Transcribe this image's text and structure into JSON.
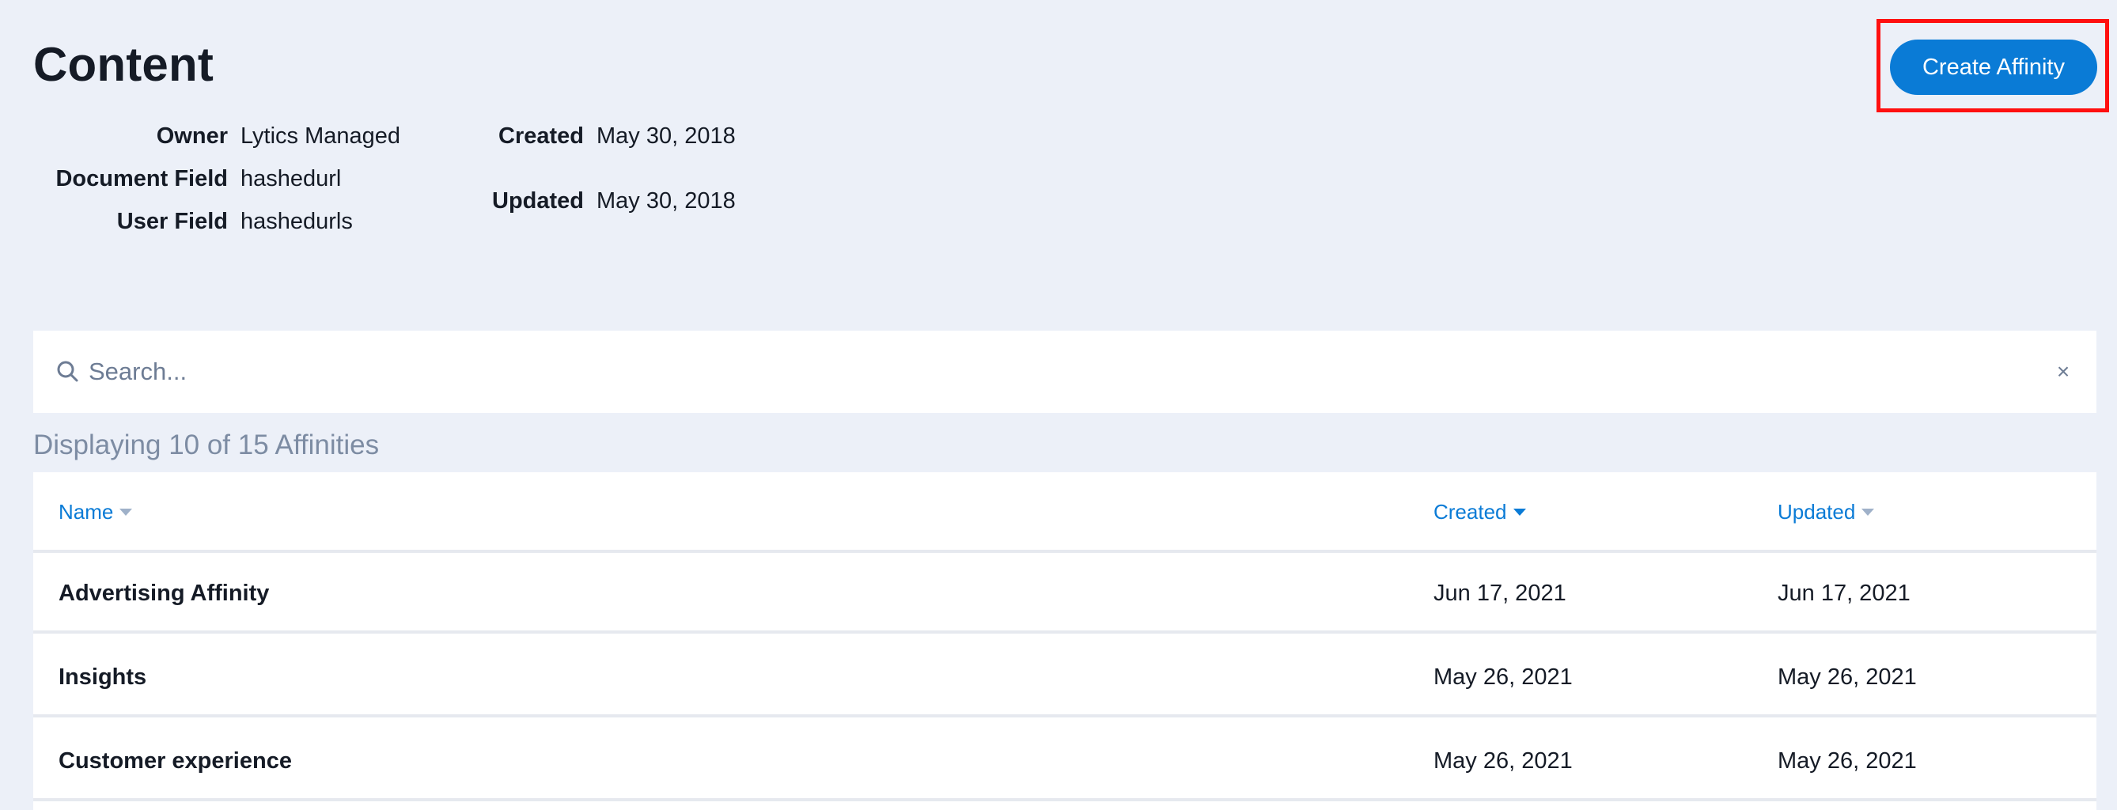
{
  "header": {
    "title": "Content",
    "create_button_label": "Create Affinity"
  },
  "meta": {
    "owner_label": "Owner",
    "owner_value": "Lytics Managed",
    "document_field_label": "Document Field",
    "document_field_value": "hashedurl",
    "user_field_label": "User Field",
    "user_field_value": "hashedurls",
    "created_label": "Created",
    "created_value": "May 30, 2018",
    "updated_label": "Updated",
    "updated_value": "May 30, 2018"
  },
  "search": {
    "placeholder": "Search...",
    "icon": "search-icon",
    "clear_glyph": "×"
  },
  "list": {
    "count_text": "Displaying 10 of 15 Affinities",
    "columns": {
      "name": "Name",
      "created": "Created",
      "updated": "Updated"
    },
    "sorted_column": "created",
    "rows": [
      {
        "name": "Advertising Affinity",
        "created": "Jun 17, 2021",
        "updated": "Jun 17, 2021"
      },
      {
        "name": "Insights",
        "created": "May 26, 2021",
        "updated": "May 26, 2021"
      },
      {
        "name": "Customer experience",
        "created": "May 26, 2021",
        "updated": "May 26, 2021"
      }
    ]
  },
  "colors": {
    "accent": "#0a7bd6",
    "highlight_border": "#ff1010",
    "background": "#ecf0f8"
  }
}
